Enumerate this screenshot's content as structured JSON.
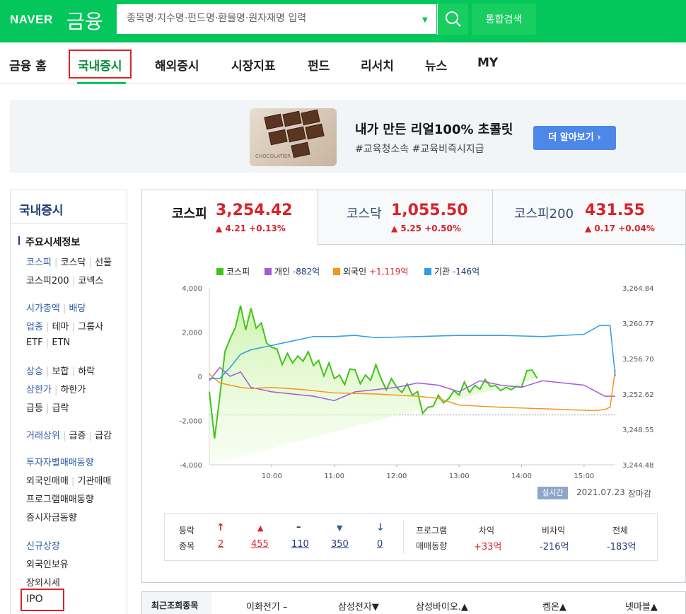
{
  "header": {
    "logo": "NAVER",
    "section": "금융",
    "search_placeholder": "종목명·지수명·펀드명·환율명·원자재명 입력",
    "dropdown_icon": "chevron-down-icon",
    "search_icon": "search-icon",
    "integrated_search": "통합검색"
  },
  "nav": {
    "items": [
      "금융 홈",
      "국내증시",
      "해외증시",
      "시장지표",
      "펀드",
      "리서치",
      "뉴스",
      "MY"
    ],
    "selected": "국내증시"
  },
  "banner": {
    "title": "내가 만든 리얼100% 초콜릿",
    "subtitle": "#교육청소속 #교육비즉시지급",
    "button": "더 알아보기 ›",
    "image_text": "CHOCOLATIER"
  },
  "sidebar": {
    "title": "국내증시",
    "heading": "주요시세정보",
    "row1": [
      "코스피",
      "코스닥",
      "선물"
    ],
    "row2": [
      "코스피200",
      "코넥스"
    ],
    "row3": [
      "시가총액",
      "배당"
    ],
    "row4": [
      "업종",
      "테마",
      "그룹사"
    ],
    "row5": [
      "ETF",
      "ETN"
    ],
    "row6": [
      "상승",
      "보합",
      "하락"
    ],
    "row7": [
      "상한가",
      "하한가"
    ],
    "row8": [
      "급등",
      "급락"
    ],
    "row9": [
      "거래상위",
      "급증",
      "급감"
    ],
    "inv_title": "투자자별매매동향",
    "row10": [
      "외국인매매",
      "기관매매"
    ],
    "program": "프로그램매매동향",
    "deposit": "증시자금동향",
    "new_title": "신규상장",
    "foreign_hold": "외국인보유",
    "otc": "장외시세",
    "ipo": "IPO"
  },
  "tabs": [
    {
      "name": "코스피",
      "value": "3,254.42",
      "change": "▲ 4.21 +0.13%"
    },
    {
      "name": "코스닥",
      "value": "1,055.50",
      "change": "▲ 5.25 +0.50%"
    },
    {
      "name": "코스피200",
      "value": "431.55",
      "change": "▲ 0.17 +0.04%"
    }
  ],
  "legend": [
    {
      "name": "코스피",
      "color": "#3fc41a"
    },
    {
      "name": "개인",
      "value": "-882억",
      "color": "#a35bd8"
    },
    {
      "name": "외국인",
      "value": "+1,119억",
      "color": "#f7931e"
    },
    {
      "name": "기관",
      "value": "-146억",
      "color": "#2f9be9"
    }
  ],
  "chart_data": {
    "type": "line",
    "x_ticks": [
      "10:00",
      "11:00",
      "12:00",
      "13:00",
      "14:00",
      "15:00"
    ],
    "y_left_ticks": [
      "4,000",
      "2,000",
      "0",
      "-2,000",
      "-4,000"
    ],
    "y_right_ticks": [
      "3,264.84",
      "3,260.77",
      "3,256.70",
      "3,252.62",
      "3,248.55",
      "3,244.48"
    ],
    "y_left_range": [
      -4000,
      4000
    ],
    "y_right_range": [
      3244.48,
      3264.84
    ],
    "x_range_minutes": [
      540,
      930
    ],
    "reference_line_kospi": 3250.21,
    "series": [
      {
        "name": "코스피",
        "axis": "right",
        "color": "#3fc41a",
        "t": [
          540,
          545,
          550,
          555,
          560,
          565,
          570,
          575,
          580,
          585,
          590,
          595,
          600,
          605,
          610,
          615,
          620,
          625,
          630,
          635,
          640,
          645,
          650,
          655,
          660,
          665,
          670,
          675,
          680,
          685,
          690,
          695,
          700,
          705,
          710,
          715,
          720,
          725,
          730,
          735,
          740,
          745,
          750,
          755,
          760,
          765,
          770,
          775,
          780,
          785,
          790,
          795,
          800,
          805,
          810,
          815,
          820,
          825,
          830,
          835,
          840,
          845,
          850,
          855,
          860,
          865,
          870,
          875,
          880,
          885,
          890,
          895,
          900,
          905,
          910,
          915,
          920,
          925,
          930
        ],
        "y": [
          3252.9,
          3247.5,
          3252.3,
          3257.5,
          3259.0,
          3260.3,
          3262.8,
          3260.0,
          3262.5,
          3260.2,
          3260.8,
          3258.5,
          3258.0,
          3257.8,
          3256.0,
          3257.3,
          3256.2,
          3257.0,
          3256.4,
          3257.5,
          3255.9,
          3256.5,
          3254.7,
          3256.2,
          3254.4,
          3254.8,
          3253.7,
          3255.5,
          3255.4,
          3253.8,
          3254.8,
          3254.2,
          3256.0,
          3254.4,
          3253.1,
          3254.4,
          3253.4,
          3252.8,
          3253.8,
          3252.5,
          3252.9,
          3250.4,
          3251.1,
          3251.2,
          3252.5,
          3251.6,
          3252.1,
          3253.0,
          3252.5,
          3254.0,
          3252.8,
          3253.6,
          3253.2,
          3254.3,
          3253.5,
          3253.6,
          3253.0,
          3253.4,
          3253.1,
          3253.5,
          3253.4,
          3255.3,
          3255.4,
          3254.42
        ]
      },
      {
        "name": "개인",
        "axis": "left",
        "color": "#a35bd8",
        "t": [
          540,
          550,
          560,
          570,
          580,
          590,
          600,
          620,
          640,
          660,
          680,
          700,
          720,
          740,
          760,
          780,
          800,
          820,
          840,
          860,
          880,
          900,
          920,
          930
        ],
        "y": [
          -200,
          400,
          0,
          200,
          -500,
          -600,
          -700,
          -800,
          -900,
          -1100,
          -700,
          -600,
          -500,
          -300,
          -400,
          -700,
          -200,
          -400,
          -500,
          -200,
          -300,
          -400,
          -900,
          -900
        ]
      },
      {
        "name": "외국인",
        "axis": "left",
        "color": "#f7931e",
        "t": [
          540,
          550,
          560,
          570,
          580,
          600,
          630,
          660,
          700,
          740,
          760,
          780,
          800,
          820,
          850,
          880,
          910,
          920,
          925,
          930
        ],
        "y": [
          100,
          -300,
          -400,
          -500,
          -550,
          -500,
          -600,
          -750,
          -800,
          -900,
          -1000,
          -1300,
          -1350,
          -1400,
          -1450,
          -1500,
          -1550,
          -1500,
          -1400,
          300
        ]
      },
      {
        "name": "기관",
        "axis": "left",
        "color": "#2f9be9",
        "t": [
          540,
          550,
          560,
          570,
          580,
          600,
          620,
          640,
          660,
          680,
          700,
          740,
          780,
          820,
          860,
          880,
          900,
          915,
          925,
          930
        ],
        "y": [
          -100,
          -100,
          400,
          1000,
          1200,
          1400,
          1600,
          1800,
          1800,
          1850,
          1750,
          1800,
          1850,
          1850,
          1800,
          1850,
          1900,
          2300,
          2300,
          0
        ]
      }
    ]
  },
  "chart_footer": {
    "realtime": "실시간",
    "date": "2021.07.23",
    "status": "장마감"
  },
  "stats": {
    "label1": "등락",
    "label2": "종목",
    "up_limit": "2",
    "up": "455",
    "flat": "110",
    "down": "350",
    "down_limit": "0",
    "program1": "프로그램",
    "program2": "매매동향",
    "arb_label": "차익",
    "arb": "+33억",
    "nonarb_label": "비차익",
    "nonarb": "-216억",
    "total_label": "전체",
    "total": "-183억"
  },
  "recent": {
    "title": "최근조회종목",
    "items": [
      "이화전기 –",
      "삼성전자▼",
      "삼성바이오.▲",
      "켐온▲",
      "넷마블▲"
    ]
  }
}
